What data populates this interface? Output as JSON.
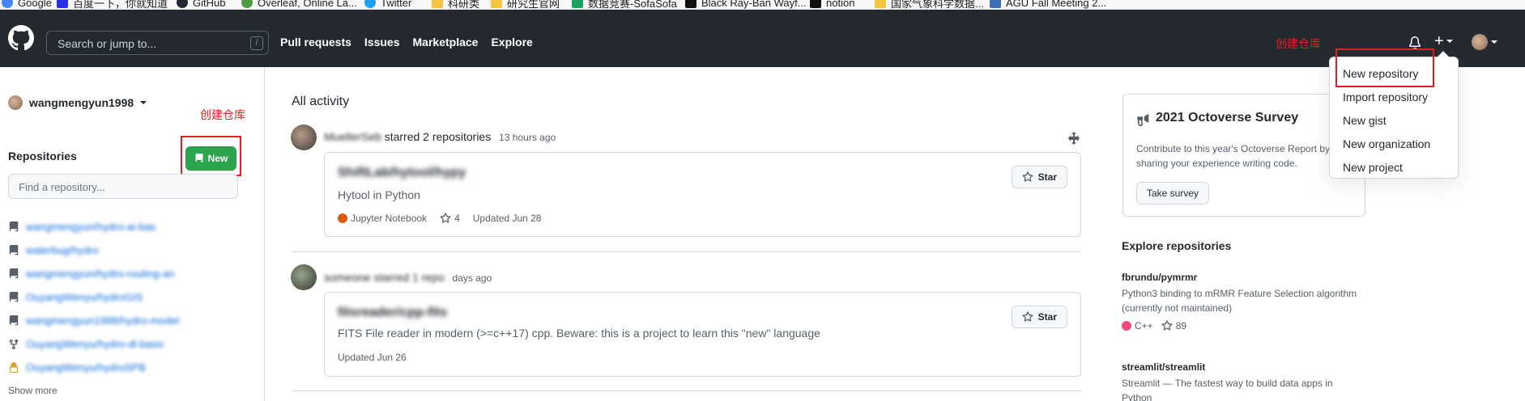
{
  "bookmarks": [
    {
      "label": "Google",
      "color": "#4285f4"
    },
    {
      "label": "百度一下，你就知道",
      "color": "#2932e1"
    },
    {
      "label": "GitHub",
      "color": "#24292f"
    },
    {
      "label": "Overleaf, Online La...",
      "color": "#4f9c45"
    },
    {
      "label": "Twitter",
      "color": "#1da1f2"
    },
    {
      "label": "科研类",
      "color": "#f4c542"
    },
    {
      "label": "研究生官网",
      "color": "#f4c542"
    },
    {
      "label": "数据竞赛-SofaSofa",
      "color": "#1aa260"
    },
    {
      "label": "Black Ray-Ban Wayf...",
      "color": "#111111"
    },
    {
      "label": "notion",
      "color": "#111111"
    },
    {
      "label": "国家气象科学数据...",
      "color": "#f4c542"
    },
    {
      "label": "AGU Fall Meeting 2...",
      "color": "#3b6fb6"
    }
  ],
  "header": {
    "search_placeholder": "Search or jump to...",
    "slash_key": "/",
    "nav": [
      "Pull requests",
      "Issues",
      "Marketplace",
      "Explore"
    ],
    "annotation": "创建仓库",
    "plus_label": "+"
  },
  "dropdown": {
    "items": [
      "New repository",
      "Import repository",
      "New gist",
      "New organization",
      "New project"
    ]
  },
  "sidebar": {
    "username": "wangmengyun1998",
    "annotation": "创建仓库",
    "repos_title": "Repositories",
    "new_button": "New",
    "find_placeholder": "Find a repository...",
    "repos": [
      {
        "name": "wangmengyun/hydro-ai-bas",
        "icon": "repo-icon"
      },
      {
        "name": "waterbug/hydro",
        "icon": "repo-icon"
      },
      {
        "name": "wangmengyun/hydro-routing-an",
        "icon": "repo-icon"
      },
      {
        "name": "OuyangWenyu/hydroGIS",
        "icon": "repo-icon"
      },
      {
        "name": "wangmengyun1998/hydro-model",
        "icon": "repo-icon"
      },
      {
        "name": "OuyangWenyu/hydro-dl-basic",
        "icon": "fork-icon"
      },
      {
        "name": "OuyangWenyu/hydroSPB",
        "icon": "lock-icon"
      }
    ],
    "show_more": "Show more"
  },
  "feed": {
    "title": "All activity",
    "events": [
      {
        "actor": "MuellerSeb",
        "action": "starred 2 repositories",
        "time": "13 hours ago",
        "card": {
          "title": "ShiftLab/hytool/hypy",
          "description": "Hytool in Python",
          "language": "Jupyter Notebook",
          "language_color": "#DA5B0B",
          "stars": "4",
          "updated": "Updated Jun 28",
          "star_label": "Star"
        }
      },
      {
        "actor": "someone starred 1 repo",
        "action": "",
        "time": "days ago",
        "card": {
          "title": "fitsreader/cpp-fits",
          "description": "FITS File reader in modern (>=c++17) cpp. Beware: this is a project to learn this \"new\" language",
          "updated": "Updated Jun 26",
          "star_label": "Star"
        }
      }
    ]
  },
  "survey": {
    "title": "2021 Octoverse Survey",
    "text": "Contribute to this year's Octoverse Report by sharing your experience writing code.",
    "button": "Take survey"
  },
  "explore": {
    "title": "Explore repositories",
    "repos": [
      {
        "name": "fbrundu/pymrmr",
        "description": "Python3 binding to mRMR Feature Selection algorithm (currently not maintained)",
        "language": "C++",
        "language_color": "#f34b7d",
        "stars": "89"
      },
      {
        "name": "streamlit/streamlit",
        "description": "Streamlit — The fastest way to build data apps in Python"
      }
    ]
  },
  "colors": {
    "header_bg": "#24292f",
    "accent_green": "#2da44e",
    "link_blue": "#0969da",
    "annotation_red": "#e02020"
  }
}
